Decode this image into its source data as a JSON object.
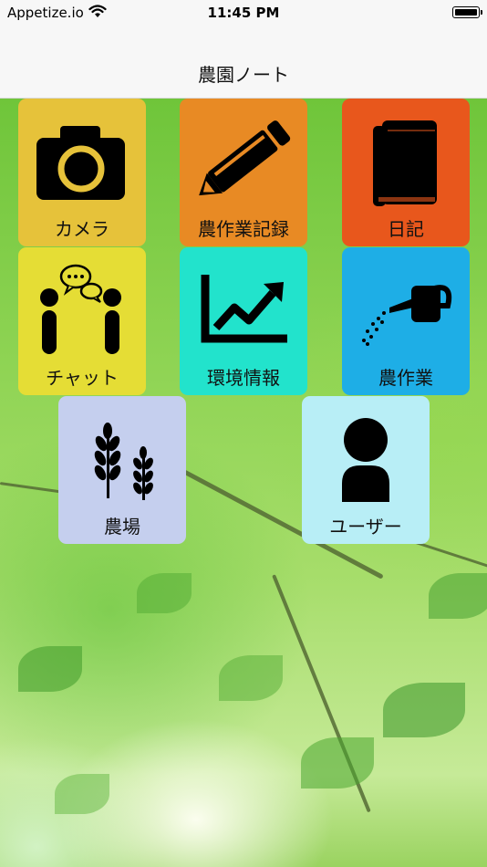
{
  "status_bar": {
    "carrier": "Appetize.io",
    "time": "11:45 PM",
    "icons": [
      "wifi-icon",
      "battery-icon"
    ]
  },
  "nav": {
    "title": "農園ノート"
  },
  "menu": {
    "camera": {
      "label": "カメラ",
      "color": "#e6c23a",
      "icon": "camera-icon"
    },
    "record": {
      "label": "農作業記録",
      "color": "#e88a24",
      "icon": "pencil-icon"
    },
    "diary": {
      "label": "日記",
      "color": "#e8571c",
      "icon": "book-icon"
    },
    "chat": {
      "label": "チャット",
      "color": "#e5dd35",
      "icon": "chat-people-icon"
    },
    "env": {
      "label": "環境情報",
      "color": "#22e3cc",
      "icon": "trend-chart-icon"
    },
    "farmwork": {
      "label": "農作業",
      "color": "#1eaee6",
      "icon": "watering-can-icon"
    },
    "farm": {
      "label": "農場",
      "color": "#c5cfee",
      "icon": "wheat-icon"
    },
    "user": {
      "label": "ユーザー",
      "color": "#b8eef6",
      "icon": "user-icon"
    }
  }
}
